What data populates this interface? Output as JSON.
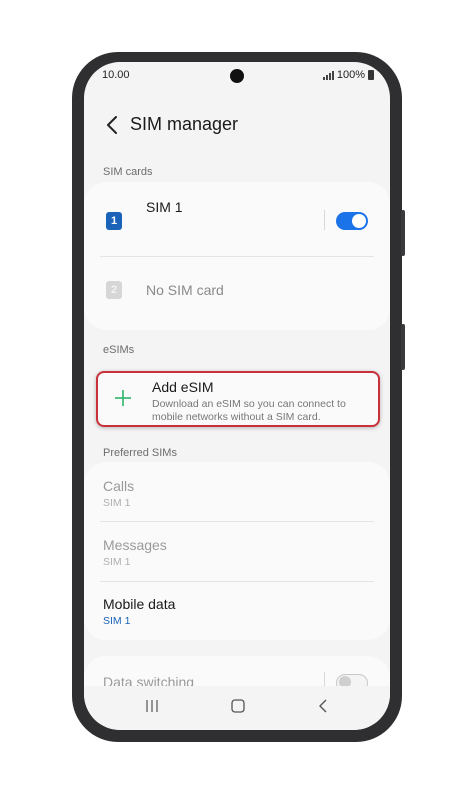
{
  "status_bar": {
    "time": "10.00",
    "battery": "100%"
  },
  "header": {
    "title": "SIM manager"
  },
  "sim_cards": {
    "section_label": "SIM cards",
    "slots": [
      {
        "badge": "1",
        "name": "SIM 1",
        "enabled": true,
        "color": "#1a63b8"
      },
      {
        "badge": "2",
        "name": "No SIM card"
      }
    ]
  },
  "esims": {
    "section_label": "eSIMs",
    "add_title": "Add eSIM",
    "add_description": "Download an eSIM so you can connect to mobile networks without a SIM card."
  },
  "preferred_sims": {
    "section_label": "Preferred SIMs",
    "items": [
      {
        "title": "Calls",
        "value": "SIM 1",
        "enabled": false
      },
      {
        "title": "Messages",
        "value": "SIM 1",
        "enabled": false
      },
      {
        "title": "Mobile data",
        "value": "SIM 1",
        "enabled": true
      }
    ]
  },
  "data_switching": {
    "label": "Data switching",
    "enabled": false
  },
  "colors": {
    "accent": "#1a73e8",
    "highlight_border": "#c8313a",
    "add_icon": "#2db46a"
  },
  "navigation": [
    "recent-apps-icon",
    "home-icon",
    "back-icon"
  ]
}
